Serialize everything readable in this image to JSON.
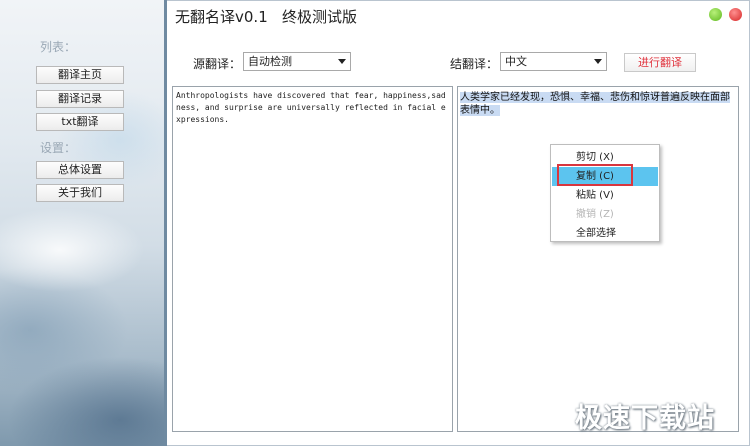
{
  "app": {
    "title": "无翻名译v0.1   终极测试版"
  },
  "sidebar": {
    "list_label": "列表：",
    "settings_label": "设置：",
    "items": [
      {
        "label": "翻译主页"
      },
      {
        "label": "翻译记录"
      },
      {
        "label": "txt翻译"
      }
    ],
    "settings_items": [
      {
        "label": "总体设置"
      },
      {
        "label": "关于我们"
      }
    ]
  },
  "source": {
    "label": "源翻译：",
    "selected": "自动检测"
  },
  "target": {
    "label": "结翻译：",
    "selected": "中文"
  },
  "translate_button": "进行翻译",
  "source_text": "Anthropologists have discovered that fear, happiness,sadness, and surprise are universally reflected in facial expressions.",
  "target_text": "人类学家已经发现，恐惧、幸福、悲伤和惊讶普遍反映在面部表情中。",
  "context_menu": {
    "items": [
      {
        "label": "剪切 (X)",
        "state": "normal"
      },
      {
        "label": "复制 (C)",
        "state": "highlighted"
      },
      {
        "label": "粘贴 (V)",
        "state": "normal"
      },
      {
        "label": "撤销 (Z)",
        "state": "disabled"
      },
      {
        "label": "全部选择",
        "state": "normal"
      }
    ]
  },
  "watermark": "极速下载站",
  "colors": {
    "highlight": "#5cc4ef",
    "accent_red": "#e0323c",
    "selection": "#c9dbf3"
  }
}
